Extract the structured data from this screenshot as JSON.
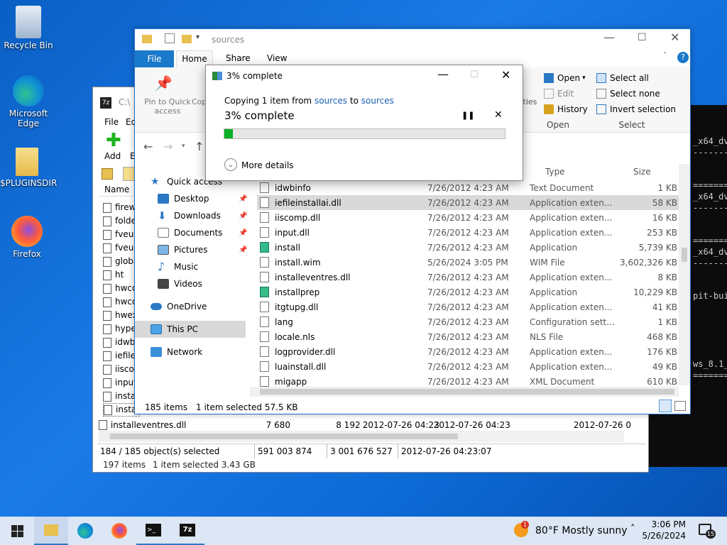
{
  "desktop": {
    "icons": [
      {
        "label": "Recycle Bin"
      },
      {
        "label": "Microsoft Edge"
      },
      {
        "label": "$PLUGINSDIR"
      },
      {
        "label": "Firefox"
      }
    ]
  },
  "terminal": {
    "lines": [
      "_x64_dv",
      "-------",
      "=======",
      "_x64_dv",
      "-------",
      "=======",
      "_x64_dv",
      "-------",
      "pit-bui",
      "",
      "ws_8.1_",
      "======="
    ]
  },
  "sevenzip": {
    "title": "C:\\",
    "menu": [
      "File",
      "Ed"
    ],
    "add_label": "Add",
    "add2_label": "E",
    "column_name": "Name",
    "rows": [
      "firew",
      "folde",
      "fveup",
      "fveup",
      "globa",
      "ht",
      "hwco",
      "hwco",
      "hwex",
      "hype",
      "idwb",
      "iefile",
      "iiscor",
      "input",
      "instal",
      "instal"
    ],
    "selected_row": {
      "name": "installeventres.dll",
      "size": "7 680",
      "packed": "8 192",
      "modified": "2012-07-26 04:23",
      "created": "2012-07-26 04:23",
      "accessed": "2012-07-26 0"
    },
    "status": {
      "selected": "184 / 185 object(s) selected",
      "size": "591 003 874",
      "packed": "3 001 676 527",
      "date": "2012-07-26 04:23:07"
    },
    "bottom": {
      "items": "197 items",
      "selected": "1 item selected  3.43 GB"
    }
  },
  "explorer": {
    "title": "sources",
    "tabs": [
      "File",
      "Home",
      "Share",
      "View"
    ],
    "ribbon": {
      "pin_label": "Pin to Quick access",
      "copy_label": "Cop",
      "properties_label": "rties",
      "open_label": "Open",
      "edit_label": "Edit",
      "history_label": "History",
      "open_group": "Open",
      "select_all": "Select all",
      "select_none": "Select none",
      "invert_selection": "Invert selection",
      "select_group": "Select"
    },
    "columns": {
      "type": "Type",
      "size": "Size"
    },
    "nav": [
      {
        "label": "Quick access"
      },
      {
        "label": "Desktop"
      },
      {
        "label": "Downloads"
      },
      {
        "label": "Documents"
      },
      {
        "label": "Pictures"
      },
      {
        "label": "Music"
      },
      {
        "label": "Videos"
      },
      {
        "label": "OneDrive"
      },
      {
        "label": "This PC"
      },
      {
        "label": "Network"
      }
    ],
    "files": [
      {
        "name": "idwbinfo",
        "date": "7/26/2012 4:23 AM",
        "type": "Text Document",
        "size": "1 KB"
      },
      {
        "name": "iefileinstallai.dll",
        "date": "7/26/2012 4:23 AM",
        "type": "Application exten...",
        "size": "58 KB"
      },
      {
        "name": "iiscomp.dll",
        "date": "7/26/2012 4:23 AM",
        "type": "Application exten...",
        "size": "16 KB"
      },
      {
        "name": "input.dll",
        "date": "7/26/2012 4:23 AM",
        "type": "Application exten...",
        "size": "253 KB"
      },
      {
        "name": "install",
        "date": "7/26/2012 4:23 AM",
        "type": "Application",
        "size": "5,739 KB"
      },
      {
        "name": "install.wim",
        "date": "5/26/2024 3:05 PM",
        "type": "WIM File",
        "size": "3,602,326 KB"
      },
      {
        "name": "installeventres.dll",
        "date": "7/26/2012 4:23 AM",
        "type": "Application exten...",
        "size": "8 KB"
      },
      {
        "name": "installprep",
        "date": "7/26/2012 4:23 AM",
        "type": "Application",
        "size": "10,229 KB"
      },
      {
        "name": "itgtupg.dll",
        "date": "7/26/2012 4:23 AM",
        "type": "Application exten...",
        "size": "41 KB"
      },
      {
        "name": "lang",
        "date": "7/26/2012 4:23 AM",
        "type": "Configuration sett...",
        "size": "1 KB"
      },
      {
        "name": "locale.nls",
        "date": "7/26/2012 4:23 AM",
        "type": "NLS File",
        "size": "468 KB"
      },
      {
        "name": "logprovider.dll",
        "date": "7/26/2012 4:23 AM",
        "type": "Application exten...",
        "size": "176 KB"
      },
      {
        "name": "luainstall.dll",
        "date": "7/26/2012 4:23 AM",
        "type": "Application exten...",
        "size": "49 KB"
      },
      {
        "name": "migapp",
        "date": "7/26/2012 4:23 AM",
        "type": "XML Document",
        "size": "610 KB"
      }
    ],
    "status": {
      "items": "185 items",
      "selected": "1 item selected  57.5 KB"
    }
  },
  "dialog": {
    "title": "3% complete",
    "copying_prefix": "Copying 1 item from ",
    "from": "sources",
    "to_word": " to ",
    "to": "sources",
    "headline": "3% complete",
    "progress": 0.03,
    "more_details": "More details"
  },
  "taskbar": {
    "weather": "80°F  Mostly sunny",
    "time": "3:06 PM",
    "date": "5/26/2024",
    "notifications": "15"
  }
}
